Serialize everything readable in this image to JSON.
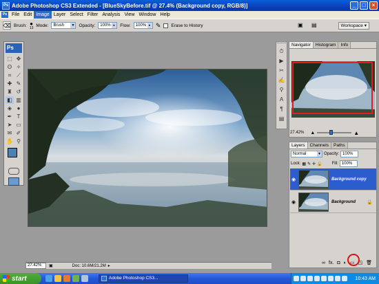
{
  "window": {
    "title": "Adobe Photoshop CS3 Extended - [BlueSkyBefore.tif @ 27.4% (Background copy, RGB/8)]"
  },
  "menu": [
    "File",
    "Edit",
    "Image",
    "Layer",
    "Select",
    "Filter",
    "Analysis",
    "View",
    "Window",
    "Help"
  ],
  "menu_active": "Image",
  "options": {
    "brush_label": "Brush:",
    "brush_size": "13",
    "mode_label": "Mode:",
    "mode_value": "Brush",
    "opacity_label": "Opacity:",
    "opacity_value": "100%",
    "flow_label": "Flow:",
    "flow_value": "100%",
    "erase_history_label": "Erase to History",
    "workspace_label": "Workspace"
  },
  "toolbox": {
    "logo": "Ps"
  },
  "navigator": {
    "tabs": [
      "Navigator",
      "Histogram",
      "Info"
    ],
    "zoom": "27.42%"
  },
  "layers": {
    "tabs": [
      "Layers",
      "Channels",
      "Paths"
    ],
    "blend_mode": "Normal",
    "opacity_label": "Opacity:",
    "opacity_value": "100%",
    "lock_label": "Lock:",
    "fill_label": "Fill:",
    "fill_value": "100%",
    "items": [
      {
        "name": "Background copy",
        "selected": true
      },
      {
        "name": "Background",
        "selected": false,
        "locked": true
      }
    ],
    "footer_fx": "fx."
  },
  "status": {
    "zoom": "27.42%",
    "doc": "Doc: 10.6M/21.2M"
  },
  "taskbar": {
    "start": "start",
    "task": "Adobe Photoshop CS3...",
    "clock": "10:43 AM"
  },
  "colors": {
    "title_bar": "#0a4fd0",
    "selection": "#2b5dcc",
    "highlight_circle": "#e01010",
    "foreground_swatch": "#4a82b4"
  }
}
